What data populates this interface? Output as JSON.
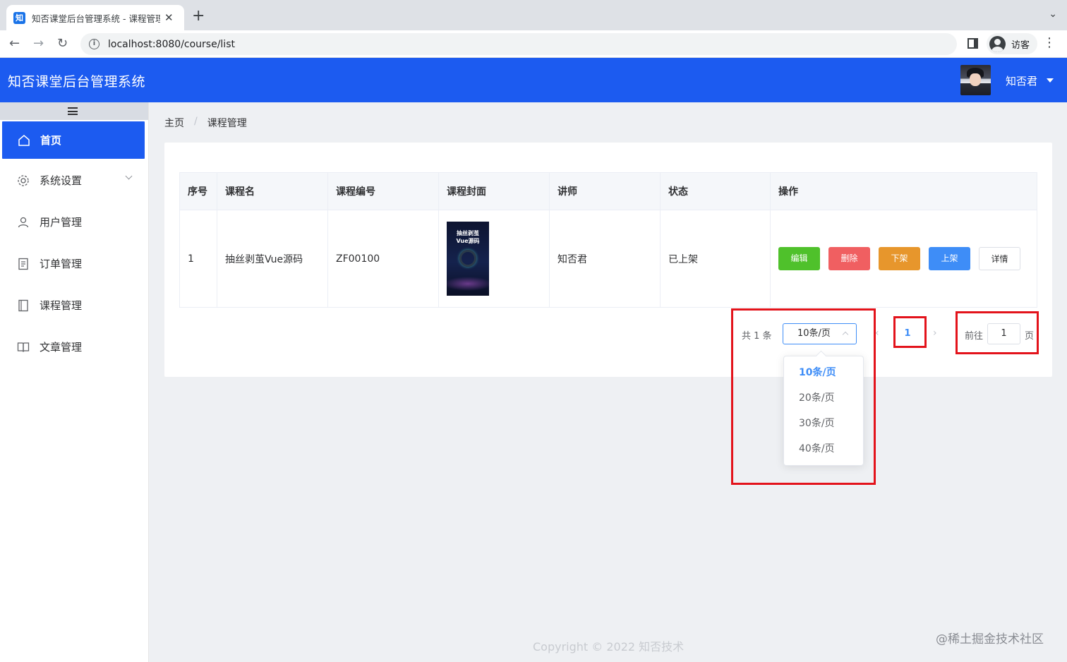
{
  "browser": {
    "tab_title": "知否课堂后台管理系统 - 课程管理",
    "favicon_text": "知",
    "url": "localhost:8080/course/list",
    "profile_label": "访客"
  },
  "header": {
    "title": "知否课堂后台管理系统",
    "user_name": "知否君",
    "bg_color": "#1c5bf0"
  },
  "sidebar": {
    "items": [
      {
        "label": "首页",
        "icon": "home-icon",
        "active": true
      },
      {
        "label": "系统设置",
        "icon": "gear-icon",
        "has_submenu": true
      },
      {
        "label": "用户管理",
        "icon": "user-icon"
      },
      {
        "label": "订单管理",
        "icon": "document-icon"
      },
      {
        "label": "课程管理",
        "icon": "notebook-icon"
      },
      {
        "label": "文章管理",
        "icon": "book-icon"
      }
    ]
  },
  "breadcrumb": [
    "主页",
    "课程管理"
  ],
  "table": {
    "headers": [
      "序号",
      "课程名",
      "课程编号",
      "课程封面",
      "讲师",
      "状态",
      "操作"
    ],
    "rows": [
      {
        "index": "1",
        "name": "抽丝剥茧Vue源码",
        "code": "ZF00100",
        "cover_text": [
          "抽丝剥茧",
          "Vue源码"
        ],
        "teacher": "知否君",
        "status": "已上架"
      }
    ],
    "actions": [
      "编辑",
      "删除",
      "下架",
      "上架",
      "详情"
    ]
  },
  "pagination": {
    "total_text": "共 1 条",
    "page_size": "10条/页",
    "current_page": "1",
    "goto_label": "前往",
    "goto_value": "1",
    "goto_suffix": "页",
    "size_options": [
      "10条/页",
      "20条/页",
      "30条/页",
      "40条/页"
    ]
  },
  "footer": {
    "copyright": "Copyright © 2022 知否技术",
    "watermark": "@稀土掘金技术社区"
  },
  "colors": {
    "primary": "#1c5bf0",
    "success": "#4fc12b",
    "danger": "#f05f61",
    "warning": "#e7962c",
    "info": "#3e8df7",
    "highlight": "#e3131b"
  }
}
